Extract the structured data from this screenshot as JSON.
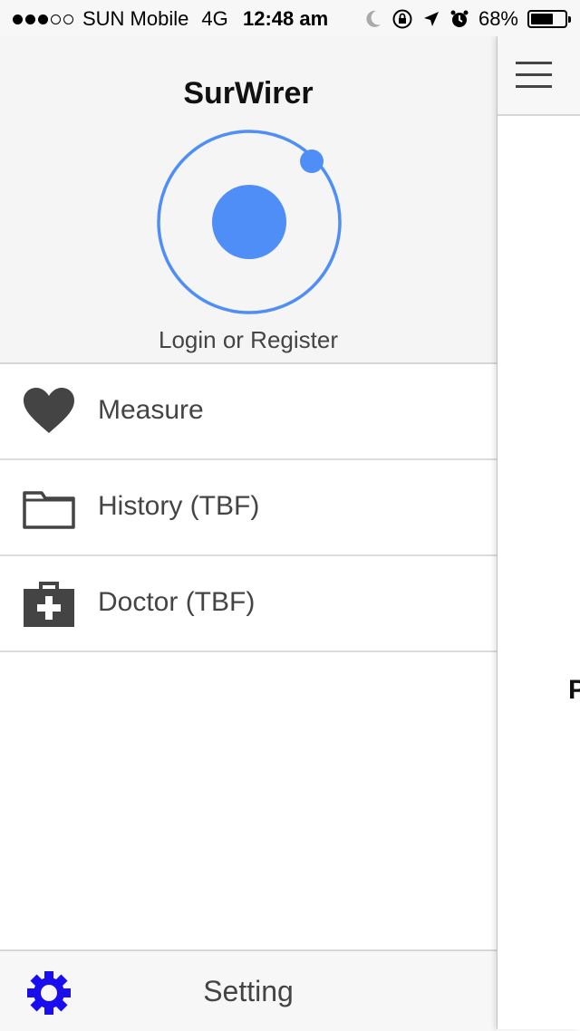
{
  "status_bar": {
    "carrier": "SUN Mobile",
    "network": "4G",
    "time": "12:48 am",
    "battery": "68%",
    "battery_level": 0.68
  },
  "side_menu": {
    "title": "SurWirer",
    "login": "Login or Register",
    "items": [
      {
        "label": "Measure",
        "icon": "heart-icon"
      },
      {
        "label": "History (TBF)",
        "icon": "folder-icon"
      },
      {
        "label": "Doctor (TBF)",
        "icon": "medical-kit-icon"
      }
    ],
    "settings": {
      "label": "Setting",
      "icon": "gear-icon"
    }
  },
  "main": {
    "clipped_text": "P"
  },
  "colors": {
    "accent_blue": "#4f8ef7",
    "gear_blue": "#1a0dee",
    "icon_dark": "#444444"
  }
}
